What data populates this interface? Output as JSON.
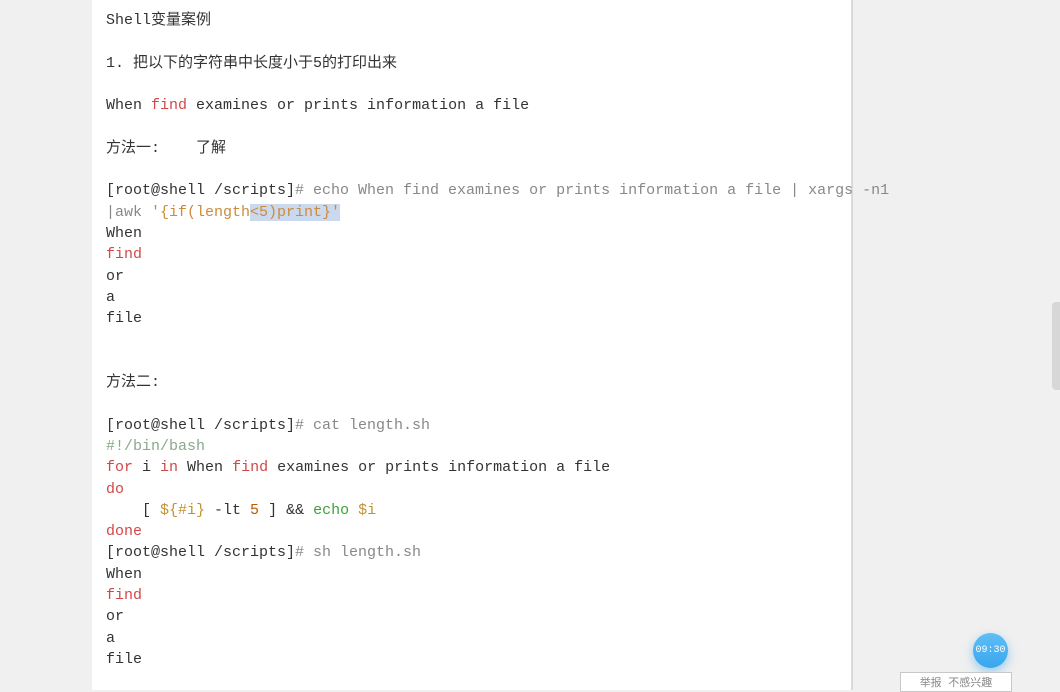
{
  "title_line": "Shell变量案例",
  "task_line": "1. 把以下的字符串中长度小于5的打印出来",
  "sample_pre": "When ",
  "sample_find": "find",
  "sample_post": " examines or prints information a file",
  "method1_label": "方法一:    了解",
  "m1_prompt": "[root@shell /scripts]",
  "m1_cmd_a": "# echo When find examines or prints information a file | xargs -n1 ",
  "m1_cmd_b_pre": "|awk ",
  "m1_cmd_b_q1": "'{if(length",
  "m1_cmd_b_sel": "<5)print}'",
  "out1": "When",
  "out2": "find",
  "out3": "or",
  "out4": "a",
  "out5": "file",
  "method2_label": "方法二:",
  "m2_prompt": "[root@shell /scripts]",
  "m2_cat": "# cat length.sh",
  "shebang": "#!/bin/bash",
  "for_kw": "for",
  "for_i": " i ",
  "in_kw": "in",
  "for_words_pre": " When ",
  "for_find": "find",
  "for_words_post": " examines or prints information a file",
  "do_kw": "do",
  "cond_pad": "    [ ",
  "cond_var": "${#i}",
  "cond_op": " -lt ",
  "cond_num": "5",
  "cond_mid": " ] && ",
  "echo_kw": "echo",
  "echo_arg": " $i",
  "done_kw": "done",
  "m2_sh": "# sh length.sh",
  "badge_time": "09:30",
  "tab_hint": "举报   不感兴趣"
}
